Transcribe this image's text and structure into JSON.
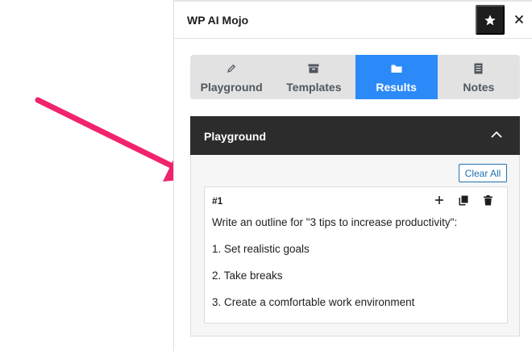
{
  "panel": {
    "title": "WP AI Mojo"
  },
  "tabs": [
    {
      "label": "Playground",
      "icon": "pencil-icon",
      "active": false
    },
    {
      "label": "Templates",
      "icon": "archive-icon",
      "active": false
    },
    {
      "label": "Results",
      "icon": "folder-icon",
      "active": true
    },
    {
      "label": "Notes",
      "icon": "document-icon",
      "active": false
    }
  ],
  "section": {
    "title": "Playground",
    "clear_label": "Clear All"
  },
  "result": {
    "number": "#1",
    "lines": [
      "Write an outline for \"3 tips to increase productivity\":",
      "1. Set realistic goals",
      "2. Take breaks",
      "3. Create a comfortable work environment"
    ]
  },
  "colors": {
    "accent": "#2b8af8",
    "arrow": "#f0246e",
    "dark": "#2c2c2c",
    "link": "#2271b1"
  }
}
